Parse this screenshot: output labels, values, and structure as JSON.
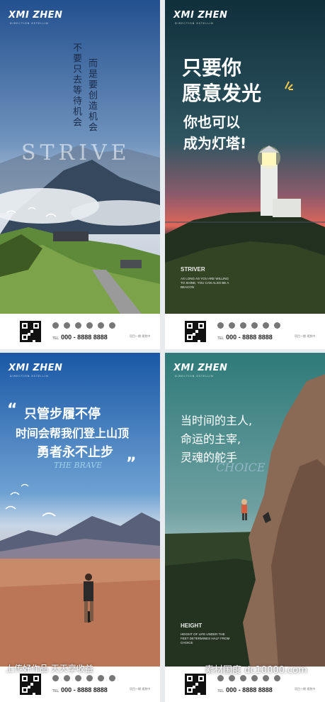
{
  "posters": [
    {
      "brand": "XMI ZHEN",
      "brand_sub": "DIRECTION ESTELLIN",
      "vertical_line_1": "不要只去等待机会",
      "vertical_line_2": "而是要创造机会",
      "watermark_word": "STRIVE",
      "footer": {
        "tel_label": "TEL",
        "tel": "000 - 8888 8888",
        "side_note": "项目一期 规划中"
      }
    },
    {
      "brand": "XMI ZHEN",
      "brand_sub": "DIRECTION ESTELLIN",
      "headline_1": "只要你",
      "headline_2": "愿意发光",
      "headline_3": "你也可以",
      "headline_4": "成为灯塔!",
      "caption_title": "STRIVER",
      "caption_body": "AS LONG AS YOU ARE WILLING TO SHINE, YOU CAN ALSO BE A BEACON",
      "footer": {
        "tel_label": "TEL",
        "tel": "000 - 8888 8888",
        "side_note": "项目一期 规划中"
      }
    },
    {
      "brand": "XMI ZHEN",
      "brand_sub": "DIRECTION ESTELLIN",
      "quote_open": "“",
      "line_1": "只管步履不停",
      "line_2": "时间会帮我们登上山顶",
      "line_3": "勇者永不止步",
      "script": "THE BRAVE",
      "quote_close": "”",
      "footer": {
        "tel_label": "TEL",
        "tel": "000 - 8888 8888",
        "side_note": "项目一期 规划中"
      },
      "watermark": "上传好作品 天天享收益"
    },
    {
      "brand": "XMI ZHEN",
      "brand_sub": "DIRECTION ESTELLIN",
      "line_1": "当时间的主人,",
      "line_2": "命运的主宰,",
      "line_3": "灵魂的舵手",
      "script": "CHOICE",
      "caption_title": "HEIGHT",
      "caption_body": "HEIGHT OF LIFE UNDER THE FEET DETERMINES HALF FROM CHOICE",
      "footer": {
        "tel_label": "TEL",
        "tel": "000 - 8888 8888",
        "side_note": "项目一期 规划中"
      },
      "watermark": "素材国度 dc10000.com"
    }
  ],
  "colors": {
    "p1_sky_top": "#2f5fa3",
    "p1_sky_bottom": "#c9d6e3",
    "p2_sky_top": "#153a45",
    "p2_sunset": "#e1665a",
    "p3_sky_top": "#1f5fa8",
    "p3_sand": "#c9805f",
    "p4_sky": "#2c6e70",
    "rock": "#8a6a55"
  }
}
